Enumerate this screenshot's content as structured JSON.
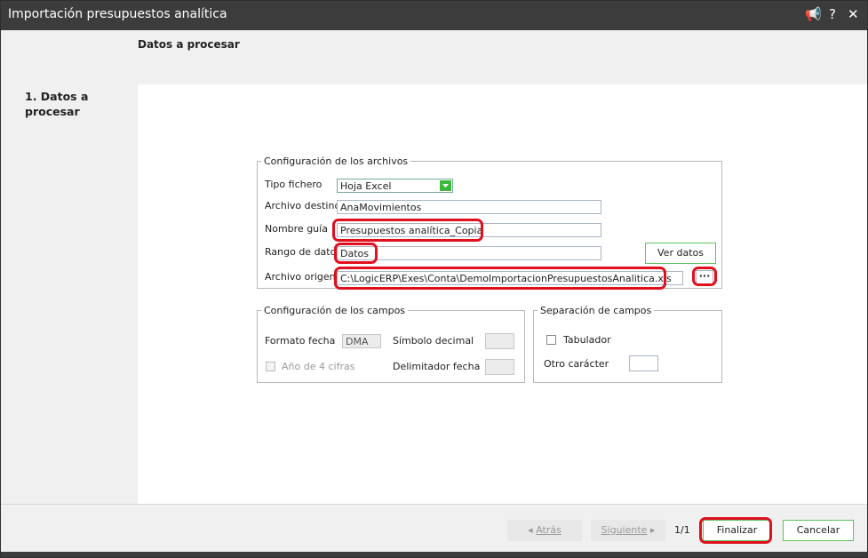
{
  "window": {
    "title": "Importación presupuestos analítica"
  },
  "title_controls": {
    "pin": "📢",
    "help": "?",
    "close": "✕"
  },
  "header": {
    "step_title": "Datos a procesar"
  },
  "sidebar": {
    "step_label": "1. Datos a procesar"
  },
  "files_group": {
    "legend": "Configuración de los archivos",
    "tipo_label": "Tipo fichero",
    "tipo_value": "Hoja Excel",
    "destino_label": "Archivo destino",
    "destino_value": "AnaMovimientos",
    "guia_label": "Nombre guía",
    "guia_value": "Presupuestos analítica_Copia",
    "rango_label": "Rango de dato",
    "rango_value": "Datos",
    "ver_datos": "Ver datos",
    "origen_label": "Archivo origen",
    "origen_value": "C:\\LogicERP\\Exes\\Conta\\DemoImportacionPresupuestosAnalitica.xls",
    "browse": "···"
  },
  "fields_group": {
    "legend": "Configuración de los campos",
    "formato_label": "Formato fecha",
    "formato_value": "DMA",
    "simbolo_label": "Símbolo decimal",
    "anio_label": "Año de 4 cifras",
    "delim_label": "Delimitador fecha"
  },
  "sep_group": {
    "legend": "Separación de campos",
    "tab_label": "Tabulador",
    "otro_label": "Otro carácter"
  },
  "footer": {
    "back": "Atrás",
    "next": "Siguiente",
    "page": "1/1",
    "finish": "Finalizar",
    "cancel": "Cancelar"
  },
  "colors": {
    "highlight": "#e0101e",
    "accent_green": "#5cc35c",
    "titlebar": "#3c3c3c"
  }
}
